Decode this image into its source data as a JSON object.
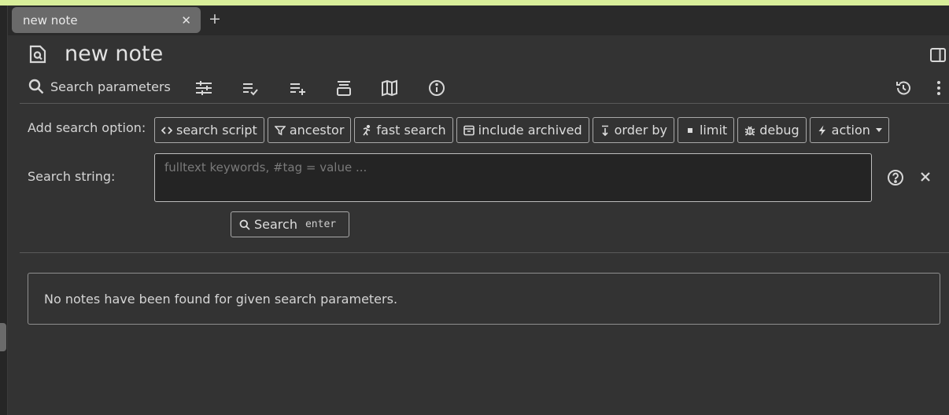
{
  "tabs": [
    {
      "title": "new note"
    }
  ],
  "note": {
    "title": "new note"
  },
  "toolbar": {
    "search_label": "Search parameters",
    "icons": [
      "sliders-icon",
      "list-check-icon",
      "list-add-icon",
      "collapse-icon",
      "map-icon",
      "info-icon"
    ],
    "right_icons": [
      "history-icon",
      "more-vertical-icon"
    ]
  },
  "search_options": {
    "label": "Add search option:",
    "buttons": [
      {
        "label": "search script",
        "icon": "code-icon"
      },
      {
        "label": "ancestor",
        "icon": "filter-icon"
      },
      {
        "label": "fast search",
        "icon": "running-icon"
      },
      {
        "label": "include archived",
        "icon": "archive-icon"
      },
      {
        "label": "order by",
        "icon": "sort-down-icon"
      },
      {
        "label": "limit",
        "icon": "square-icon"
      },
      {
        "label": "debug",
        "icon": "bug-icon"
      },
      {
        "label": "action",
        "icon": "bolt-icon"
      }
    ]
  },
  "search_string": {
    "label": "Search string:",
    "value": "",
    "placeholder": "fulltext keywords, #tag = value ..."
  },
  "search_button": {
    "label": "Search",
    "shortcut": "enter"
  },
  "results": {
    "empty_message": "No notes have been found for given search parameters."
  },
  "colors": {
    "background": "#333333",
    "tab_active": "#6a6a6a",
    "top_strip": "#d8ee9a",
    "border": "#a9a9a9"
  }
}
